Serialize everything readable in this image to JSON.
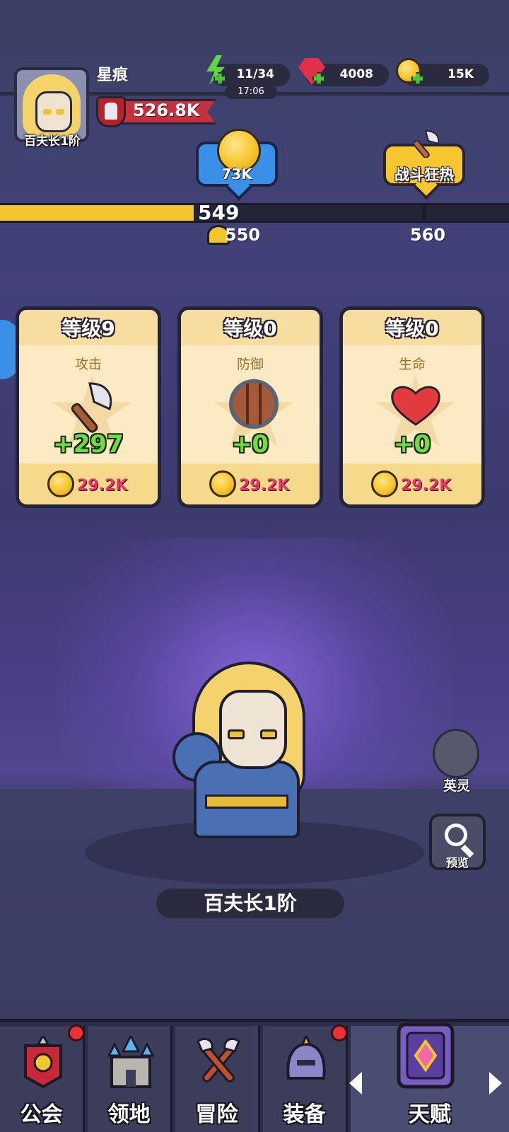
{
  "player": {
    "name": "星痕",
    "rank": "百夫长1阶",
    "power": "526.8K"
  },
  "resources": {
    "energy": "11/34",
    "energy_timer": "17:06",
    "gems": "4008",
    "gold": "15K"
  },
  "top_buttons": {
    "gold_reward": "73K",
    "battle_frenzy": "战斗狂热"
  },
  "progress": {
    "current": "549",
    "milestone_a": "550",
    "milestone_b": "560",
    "fill_fraction": 0.38
  },
  "stat_cards": [
    {
      "level": "等级9",
      "name": "攻击",
      "bonus": "+297",
      "cost": "29.2K",
      "icon": "axe-icon"
    },
    {
      "level": "等级0",
      "name": "防御",
      "bonus": "+0",
      "cost": "29.2K",
      "icon": "shield-icon"
    },
    {
      "level": "等级0",
      "name": "生命",
      "bonus": "+0",
      "cost": "29.2K",
      "icon": "heart-icon"
    }
  ],
  "hero": {
    "rank_label": "百夫长1阶"
  },
  "side_buttons": {
    "spirit": "英灵",
    "preview": "预览"
  },
  "nav": {
    "tabs": [
      {
        "label": "公会",
        "icon": "guild-banner-icon",
        "badge": true
      },
      {
        "label": "领地",
        "icon": "castle-icon",
        "badge": false
      },
      {
        "label": "冒险",
        "icon": "crossed-axes-icon",
        "badge": false
      },
      {
        "label": "装备",
        "icon": "helmet-icon",
        "badge": true
      },
      {
        "label": "天赋",
        "icon": "talent-book-icon",
        "badge": false
      }
    ]
  },
  "colors": {
    "accent_gold": "#f3c62e",
    "cost_text": "#e03a6a",
    "bonus_text": "#6edb47",
    "badge_red": "#e8323a"
  }
}
